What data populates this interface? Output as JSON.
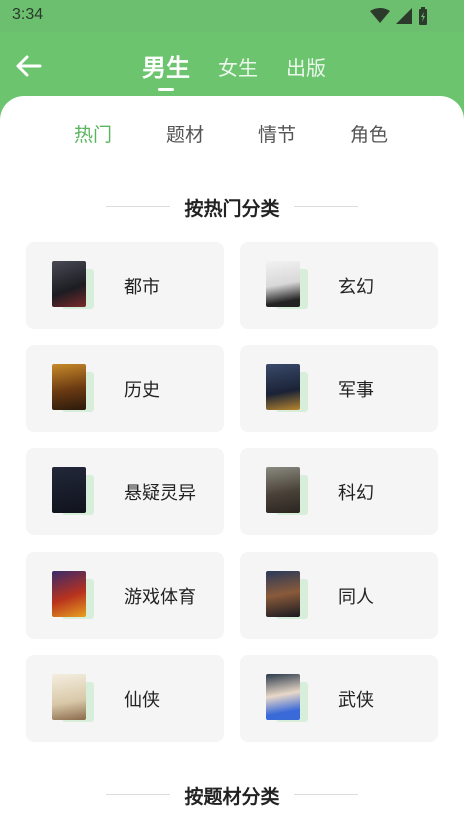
{
  "status_bar": {
    "time": "3:34"
  },
  "header": {
    "tabs": [
      {
        "label": "男生",
        "active": true
      },
      {
        "label": "女生",
        "active": false
      },
      {
        "label": "出版",
        "active": false
      }
    ]
  },
  "sub_tabs": [
    {
      "label": "热门",
      "active": true
    },
    {
      "label": "题材",
      "active": false
    },
    {
      "label": "情节",
      "active": false
    },
    {
      "label": "角色",
      "active": false
    }
  ],
  "sections": [
    {
      "title": "按热门分类"
    },
    {
      "title": "按题材分类"
    }
  ],
  "categories": [
    {
      "label": "都市"
    },
    {
      "label": "玄幻"
    },
    {
      "label": "历史"
    },
    {
      "label": "军事"
    },
    {
      "label": "悬疑灵异"
    },
    {
      "label": "科幻"
    },
    {
      "label": "游戏体育"
    },
    {
      "label": "同人"
    },
    {
      "label": "仙侠"
    },
    {
      "label": "武侠"
    }
  ],
  "colors": {
    "accent": "#5ab55e",
    "header_bg": "#6cc46f",
    "card_bg": "#f5f5f5"
  }
}
